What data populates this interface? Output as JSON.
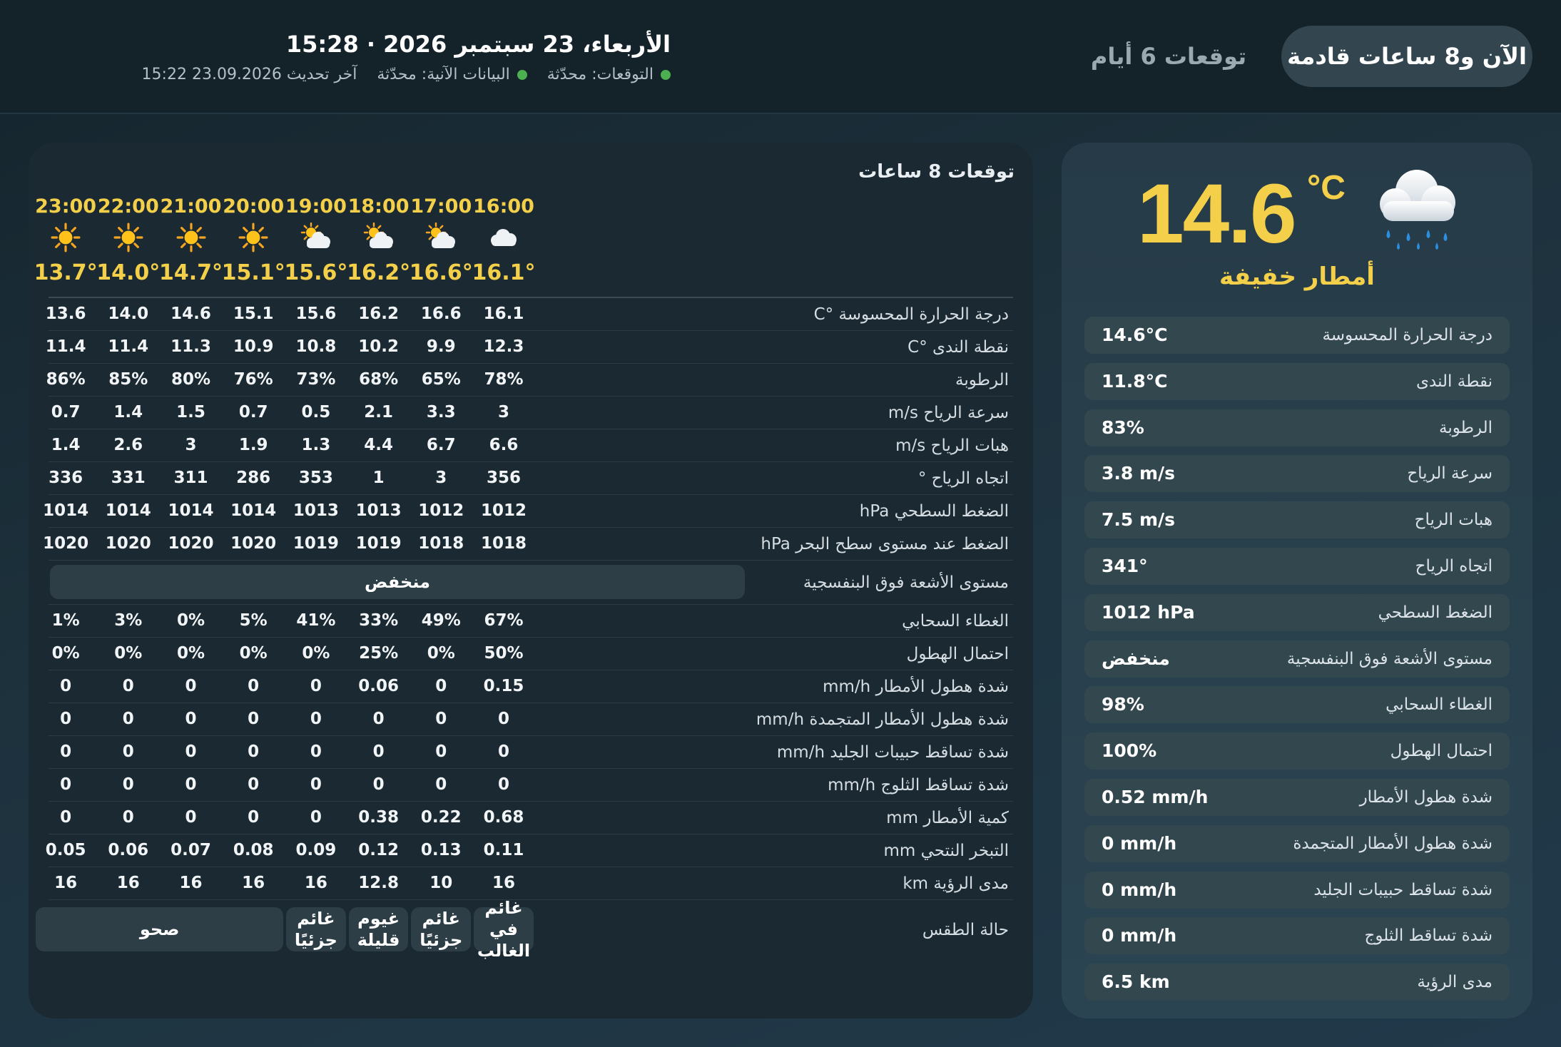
{
  "header": {
    "tabs": {
      "now": "الآن و8 ساعات قادمة",
      "six_days": "توقعات 6 أيام"
    },
    "date_time": "الأربعاء، 23 سبتمبر 2026 · 15:28",
    "last_update": "آخر تحديث 23.09.2026 15:22",
    "live_status": "البيانات الآنية: محدّثة",
    "forecast_status": "التوقعات: محدّثة",
    "status_color": "#4caf50"
  },
  "forecast": {
    "title": "توقعات 8 ساعات",
    "hours": [
      {
        "time": "16:00",
        "icon": "cloud-icon",
        "temp": "16.1°"
      },
      {
        "time": "17:00",
        "icon": "sun-behind-cloud-icon",
        "temp": "16.6°"
      },
      {
        "time": "18:00",
        "icon": "sun-behind-cloud-icon",
        "temp": "16.2°"
      },
      {
        "time": "19:00",
        "icon": "sun-behind-cloud-icon",
        "temp": "15.6°"
      },
      {
        "time": "20:00",
        "icon": "sun-icon",
        "temp": "15.1°"
      },
      {
        "time": "21:00",
        "icon": "sun-icon",
        "temp": "14.7°"
      },
      {
        "time": "22:00",
        "icon": "sun-icon",
        "temp": "14.0°"
      },
      {
        "time": "23:00",
        "icon": "sun-icon",
        "temp": "13.7°"
      }
    ],
    "rows_top": [
      {
        "label": "درجة الحرارة المحسوسة °C",
        "values": [
          "16.1",
          "16.6",
          "16.2",
          "15.6",
          "15.1",
          "14.6",
          "14.0",
          "13.6"
        ]
      },
      {
        "label": "نقطة الندى °C",
        "values": [
          "12.3",
          "9.9",
          "10.2",
          "10.8",
          "10.9",
          "11.3",
          "11.4",
          "11.4"
        ]
      },
      {
        "label": "الرطوبة",
        "values": [
          "78%",
          "65%",
          "68%",
          "73%",
          "76%",
          "80%",
          "85%",
          "86%"
        ]
      },
      {
        "label": "سرعة الرياح m/s",
        "values": [
          "3",
          "3.3",
          "2.1",
          "0.5",
          "0.7",
          "1.5",
          "1.4",
          "0.7"
        ]
      },
      {
        "label": "هبات الرياح m/s",
        "values": [
          "6.6",
          "6.7",
          "4.4",
          "1.3",
          "1.9",
          "3",
          "2.6",
          "1.4"
        ]
      },
      {
        "label": "اتجاه الرياح °",
        "values": [
          "356",
          "3",
          "1",
          "353",
          "286",
          "311",
          "331",
          "336"
        ]
      },
      {
        "label": "الضغط السطحي hPa",
        "values": [
          "1012",
          "1012",
          "1013",
          "1013",
          "1014",
          "1014",
          "1014",
          "1014"
        ]
      },
      {
        "label": "الضغط عند مستوى سطح البحر hPa",
        "values": [
          "1018",
          "1018",
          "1019",
          "1019",
          "1020",
          "1020",
          "1020",
          "1020"
        ]
      }
    ],
    "uv": {
      "label": "مستوى الأشعة فوق البنفسجية",
      "value": "منخفض"
    },
    "rows_bottom": [
      {
        "label": "الغطاء السحابي",
        "values": [
          "67%",
          "49%",
          "33%",
          "41%",
          "5%",
          "0%",
          "3%",
          "1%"
        ]
      },
      {
        "label": "احتمال الهطول",
        "values": [
          "50%",
          "0%",
          "25%",
          "0%",
          "0%",
          "0%",
          "0%",
          "0%"
        ]
      },
      {
        "label": "شدة هطول الأمطار mm/h",
        "values": [
          "0.15",
          "0",
          "0.06",
          "0",
          "0",
          "0",
          "0",
          "0"
        ]
      },
      {
        "label": "شدة هطول الأمطار المتجمدة mm/h",
        "values": [
          "0",
          "0",
          "0",
          "0",
          "0",
          "0",
          "0",
          "0"
        ]
      },
      {
        "label": "شدة تساقط حبيبات الجليد mm/h",
        "values": [
          "0",
          "0",
          "0",
          "0",
          "0",
          "0",
          "0",
          "0"
        ]
      },
      {
        "label": "شدة تساقط الثلوج mm/h",
        "values": [
          "0",
          "0",
          "0",
          "0",
          "0",
          "0",
          "0",
          "0"
        ]
      },
      {
        "label": "كمية الأمطار mm",
        "values": [
          "0.68",
          "0.22",
          "0.38",
          "0",
          "0",
          "0",
          "0",
          "0"
        ]
      },
      {
        "label": "التبخر النتحي mm",
        "values": [
          "0.11",
          "0.13",
          "0.12",
          "0.09",
          "0.08",
          "0.07",
          "0.06",
          "0.05"
        ]
      },
      {
        "label": "مدى الرؤية km",
        "values": [
          "16",
          "10",
          "12.8",
          "16",
          "16",
          "16",
          "16",
          "16"
        ]
      }
    ],
    "condition": {
      "label": "حالة الطقس",
      "items": [
        {
          "text": "غائم في الغالب",
          "span": 1
        },
        {
          "text": "غائم جزئيًا",
          "span": 1
        },
        {
          "text": "غيوم قليلة",
          "span": 1
        },
        {
          "text": "غائم جزئيًا",
          "span": 1
        },
        {
          "text": "صحو",
          "span": 4
        }
      ]
    }
  },
  "now": {
    "temp": "14.6",
    "unit": "°C",
    "icon": "cloud-with-rain-icon",
    "description": "أمطار خفيفة",
    "rows": [
      {
        "label": "درجة الحرارة المحسوسة",
        "value": "14.6°C"
      },
      {
        "label": "نقطة الندى",
        "value": "11.8°C"
      },
      {
        "label": "الرطوبة",
        "value": "83%"
      },
      {
        "label": "سرعة الرياح",
        "value": "3.8 m/s"
      },
      {
        "label": "هبات الرياح",
        "value": "7.5 m/s"
      },
      {
        "label": "اتجاه الرياح",
        "value": "341°"
      },
      {
        "label": "الضغط السطحي",
        "value": "1012 hPa"
      },
      {
        "label": "مستوى الأشعة فوق البنفسجية",
        "value": "منخفض"
      },
      {
        "label": "الغطاء السحابي",
        "value": "98%"
      },
      {
        "label": "احتمال الهطول",
        "value": "100%"
      },
      {
        "label": "شدة هطول الأمطار",
        "value": "0.52 mm/h"
      },
      {
        "label": "شدة هطول الأمطار المتجمدة",
        "value": "0 mm/h"
      },
      {
        "label": "شدة تساقط حبيبات الجليد",
        "value": "0 mm/h"
      },
      {
        "label": "شدة تساقط الثلوج",
        "value": "0 mm/h"
      },
      {
        "label": "مدى الرؤية",
        "value": "6.5 km"
      }
    ]
  },
  "colors": {
    "accent": "#f4d04a",
    "panel": "#1b2a32",
    "pill": "#2e3e47"
  }
}
